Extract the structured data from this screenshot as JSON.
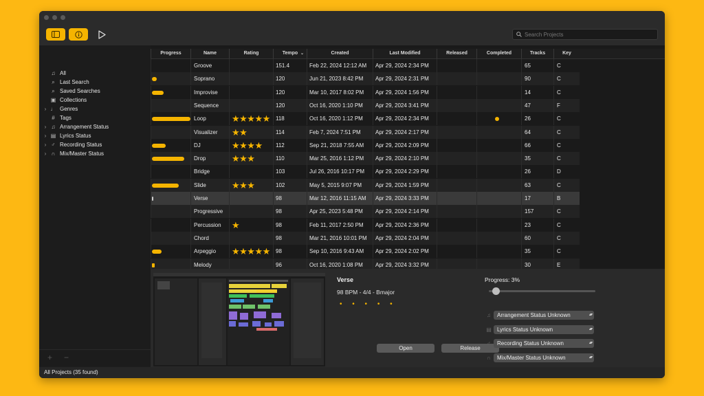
{
  "colors": {
    "background": "#FDB813",
    "accent": "#F5B400",
    "window": "#1E1E1E"
  },
  "toolbar": {
    "sidebar_toggle_icon": "sidebar-icon",
    "info_icon": "info-icon",
    "play_icon": "play-icon",
    "search_placeholder": "Search Projects"
  },
  "sidebar": {
    "items": [
      {
        "label": "All",
        "icon": "music-note-icon",
        "chevron": false
      },
      {
        "label": "Last Search",
        "icon": "search-icon",
        "chevron": false
      },
      {
        "label": "Saved Searches",
        "icon": "search-icon",
        "chevron": false
      },
      {
        "label": "Collections",
        "icon": "collection-icon",
        "chevron": false
      },
      {
        "label": "Genres",
        "icon": "guitar-icon",
        "chevron": true
      },
      {
        "label": "Tags",
        "icon": "hashtag-icon",
        "chevron": false
      },
      {
        "label": "Arrangement Status",
        "icon": "music-note-icon",
        "chevron": true
      },
      {
        "label": "Lyrics Status",
        "icon": "document-icon",
        "chevron": true
      },
      {
        "label": "Recording Status",
        "icon": "microphone-icon",
        "chevron": true
      },
      {
        "label": "Mix/Master Status",
        "icon": "headphones-icon",
        "chevron": true
      }
    ],
    "add_label": "+",
    "remove_label": "−"
  },
  "table": {
    "columns": [
      "Progress",
      "Name",
      "Rating",
      "Tempo",
      "Created",
      "Last Modified",
      "Released",
      "Completed",
      "Tracks",
      "Key"
    ],
    "sort_column": "Tempo",
    "sort_icon": "chevron-down-icon",
    "rows": [
      {
        "progress": 0,
        "name": "Groove",
        "rating": 0,
        "tempo": "151.4",
        "created": "Feb 22, 2024 12:12 AM",
        "modified": "Apr 29, 2024 2:34 PM",
        "completed": false,
        "tracks": "65",
        "key": "C"
      },
      {
        "progress": 0.13,
        "name": "Soprano",
        "rating": 0,
        "tempo": "120",
        "created": "Jun 21, 2023 8:42 PM",
        "modified": "Apr 29, 2024 2:31 PM",
        "completed": false,
        "tracks": "90",
        "key": "C"
      },
      {
        "progress": 0.31,
        "name": "Improvise",
        "rating": 0,
        "tempo": "120",
        "created": "Mar 10, 2017 8:02 PM",
        "modified": "Apr 29, 2024 1:56 PM",
        "completed": false,
        "tracks": "14",
        "key": "C"
      },
      {
        "progress": 0,
        "name": "Sequence",
        "rating": 0,
        "tempo": "120",
        "created": "Oct 16, 2020 1:10 PM",
        "modified": "Apr 29, 2024 3:41 PM",
        "completed": false,
        "tracks": "47",
        "key": "F"
      },
      {
        "progress": 1.0,
        "name": "Loop",
        "rating": 5,
        "tempo": "118",
        "created": "Oct 16, 2020 1:12 PM",
        "modified": "Apr 29, 2024 2:34 PM",
        "completed": true,
        "tracks": "26",
        "key": "C"
      },
      {
        "progress": 0,
        "name": "Visualizer",
        "rating": 2,
        "tempo": "114",
        "created": "Feb 7, 2024 7:51 PM",
        "modified": "Apr 29, 2024 2:17 PM",
        "completed": false,
        "tracks": "64",
        "key": "C"
      },
      {
        "progress": 0.36,
        "name": "DJ",
        "rating": 4,
        "tempo": "112",
        "created": "Sep 21, 2018 7:55 AM",
        "modified": "Apr 29, 2024 2:09 PM",
        "completed": false,
        "tracks": "66",
        "key": "C"
      },
      {
        "progress": 0.84,
        "name": "Drop",
        "rating": 3,
        "tempo": "110",
        "created": "Mar 25, 2016 1:12 PM",
        "modified": "Apr 29, 2024 2:10 PM",
        "completed": false,
        "tracks": "35",
        "key": "C"
      },
      {
        "progress": 0,
        "name": "Bridge",
        "rating": 0,
        "tempo": "103",
        "created": "Jul 26, 2016 10:17 PM",
        "modified": "Apr 29, 2024 2:29 PM",
        "completed": false,
        "tracks": "26",
        "key": "D"
      },
      {
        "progress": 0.69,
        "name": "Slide",
        "rating": 3,
        "tempo": "102",
        "created": "May 5, 2015 9:07 PM",
        "modified": "Apr 29, 2024 1:59 PM",
        "completed": false,
        "tracks": "63",
        "key": "C"
      },
      {
        "progress": 0.03,
        "name": "Verse",
        "rating": 0,
        "tempo": "98",
        "created": "Mar 12, 2016 11:15 AM",
        "modified": "Apr 29, 2024 3:33 PM",
        "completed": false,
        "tracks": "17",
        "key": "B"
      },
      {
        "progress": 0,
        "name": "Progressive",
        "rating": 0,
        "tempo": "98",
        "created": "Apr 25, 2023 5:48 PM",
        "modified": "Apr 29, 2024 2:14 PM",
        "completed": false,
        "tracks": "157",
        "key": "C"
      },
      {
        "progress": 0,
        "name": "Percussion",
        "rating": 1,
        "tempo": "98",
        "created": "Feb 11, 2017 2:50 PM",
        "modified": "Apr 29, 2024 2:36 PM",
        "completed": false,
        "tracks": "23",
        "key": "C"
      },
      {
        "progress": 0,
        "name": "Chord",
        "rating": 0,
        "tempo": "98",
        "created": "Mar 21, 2016 10:01 PM",
        "modified": "Apr 29, 2024 2:04 PM",
        "completed": false,
        "tracks": "60",
        "key": "C"
      },
      {
        "progress": 0.25,
        "name": "Arpeggio",
        "rating": 5,
        "tempo": "98",
        "created": "Sep 10, 2016 9:43 AM",
        "modified": "Apr 29, 2024 2:02 PM",
        "completed": false,
        "tracks": "35",
        "key": "C"
      },
      {
        "progress": 0.08,
        "name": "Melody",
        "rating": 0,
        "tempo": "96",
        "created": "Oct 16, 2020 1:08 PM",
        "modified": "Apr 29, 2024 3:32 PM",
        "completed": false,
        "tracks": "30",
        "key": "E"
      }
    ],
    "selected_index": 10
  },
  "detail": {
    "title": "Verse",
    "subtitle": "98 BPM - 4/4 - Bmajor",
    "rating_placeholder": "• • • • •",
    "open_label": "Open",
    "release_label": "Release",
    "progress_label": "Progress: 3%",
    "progress_value": 0.03,
    "statuses": [
      {
        "label": "Arrangement Status Unknown",
        "icon": "music-note-icon"
      },
      {
        "label": "Lyrics Status Unknown",
        "icon": "document-icon"
      },
      {
        "label": "Recording Status Unknown",
        "icon": "microphone-icon"
      },
      {
        "label": "Mix/Master Status Unknown",
        "icon": "headphones-icon"
      }
    ],
    "thumbnail_icon": "project-screenshot-thumbnail"
  },
  "status_bar": {
    "text": "All Projects (35 found)"
  }
}
